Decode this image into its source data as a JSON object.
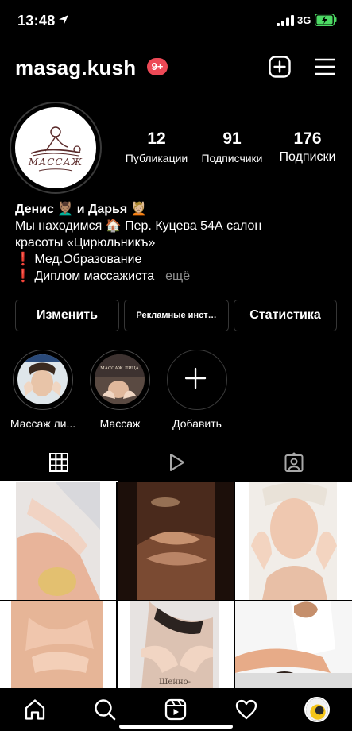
{
  "status_bar": {
    "time": "13:48",
    "network": "3G",
    "battery_color": "#4cd964"
  },
  "header": {
    "username": "masag.kush",
    "notification_badge": "9+",
    "badge_color": "#ed4956",
    "add_icon": "plus-square-icon",
    "menu_icon": "hamburger-icon"
  },
  "profile": {
    "avatar_text": "МАССАЖ",
    "stats": [
      {
        "value": "12",
        "label": "Публикации"
      },
      {
        "value": "91",
        "label": "Подписчики"
      },
      {
        "value": "176",
        "label": "Подписки"
      }
    ],
    "bio": {
      "name": "Денис 💆🏽‍♂️ и Дарья 💆🏼",
      "lines": [
        "Мы находимся 🏠 Пер. Куцева 54А салон",
        "красоты «Цирюльникъ»",
        "❗ Мед.Образование",
        "❗ Диплом массажиста"
      ],
      "more_label": "ещё"
    }
  },
  "buttons": {
    "edit": "Изменить",
    "ads": "Рекламные инст…",
    "stats": "Статистика"
  },
  "highlights": [
    {
      "label": "Массаж ли..."
    },
    {
      "label": "Массаж",
      "inner_text": "МАССАЖ ЛИЦА"
    },
    {
      "label": "Добавить"
    }
  ],
  "tabs": [
    {
      "name": "grid",
      "icon": "grid-icon"
    },
    {
      "name": "reels",
      "icon": "play-icon"
    },
    {
      "name": "tagged",
      "icon": "tagged-person-icon"
    }
  ],
  "grid_posts": [
    {
      "icon": "massage-back-photo"
    },
    {
      "icon": "massage-hands-photo",
      "overlay_text": ""
    },
    {
      "icon": "face-massage-photo"
    },
    {
      "icon": "back-massage-photo"
    },
    {
      "icon": "neck-massage-photo",
      "overlay_text": "Шейно-"
    },
    {
      "icon": "full-body-massage-photo"
    }
  ],
  "bottom_nav": [
    {
      "name": "home",
      "icon": "home-icon"
    },
    {
      "name": "search",
      "icon": "search-icon"
    },
    {
      "name": "reels",
      "icon": "reels-icon"
    },
    {
      "name": "activity",
      "icon": "heart-icon"
    },
    {
      "name": "profile",
      "icon": "profile-avatar"
    }
  ]
}
